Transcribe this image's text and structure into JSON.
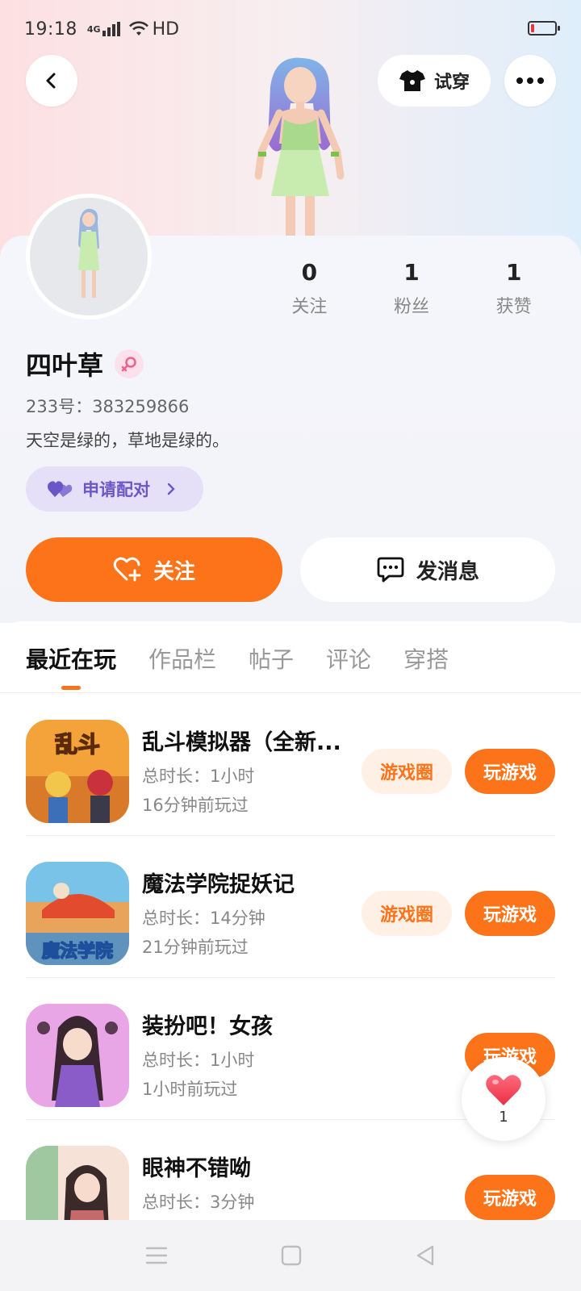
{
  "status_bar": {
    "time": "19:18",
    "signal_label": "4G",
    "network_label": "HD",
    "battery_color": "#e53935"
  },
  "header": {
    "back_icon": "chevron-left-icon",
    "tryon_label": "试穿",
    "tryon_icon": "tshirt-icon",
    "more_icon": "more-dots-icon"
  },
  "profile": {
    "stats": [
      {
        "value": "0",
        "label": "关注"
      },
      {
        "value": "1",
        "label": "粉丝"
      },
      {
        "value": "1",
        "label": "获赞"
      }
    ],
    "name": "四叶草",
    "gender_icon": "female-icon",
    "uid": "233号：383259866",
    "bio": "天空是绿的，草地是绿的。",
    "pair_label": "申请配对",
    "pair_icon": "hearts-icon"
  },
  "actions": {
    "follow_label": "关注",
    "message_label": "发消息",
    "accent_color": "#fd7319"
  },
  "tabs": [
    {
      "label": "最近在玩",
      "active": true
    },
    {
      "label": "作品栏",
      "active": false
    },
    {
      "label": "帖子",
      "active": false
    },
    {
      "label": "评论",
      "active": false
    },
    {
      "label": "穿搭",
      "active": false
    }
  ],
  "games": [
    {
      "title": "乱斗模拟器（全新...",
      "duration": "总时长：1小时",
      "last_played": "16分钟前玩过",
      "circle_label": "游戏圈",
      "play_label": "玩游戏",
      "icon_text": "乱斗"
    },
    {
      "title": "魔法学院捉妖记",
      "duration": "总时长：14分钟",
      "last_played": "21分钟前玩过",
      "circle_label": "游戏圈",
      "play_label": "玩游戏",
      "icon_text": "魔法学院"
    },
    {
      "title": "装扮吧！女孩",
      "duration": "总时长：1小时",
      "last_played": "1小时前玩过",
      "play_label": "玩游戏"
    },
    {
      "title": "眼神不错呦",
      "duration": "总时长：3分钟",
      "last_played": "",
      "play_label": "玩游戏"
    }
  ],
  "like_float": {
    "count": "1",
    "icon": "heart-icon"
  },
  "nav_bar": {
    "icons": [
      "menu-icon",
      "home-square-icon",
      "back-triangle-icon"
    ]
  }
}
